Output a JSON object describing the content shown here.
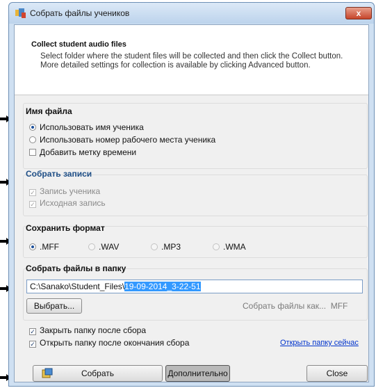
{
  "window": {
    "title": "Собрать файлы учеников",
    "close_label": "x"
  },
  "header": {
    "title": "Collect student audio files",
    "description": "Select folder where the student files will be collected and then click the Collect button. More detailed settings for collection is available by clicking Advanced button."
  },
  "filename_group": {
    "title": "Имя файла",
    "options": [
      {
        "label": "Использовать имя ученика",
        "selected": true
      },
      {
        "label": "Использовать номер рабочего места ученика",
        "selected": false
      }
    ],
    "timestamp_label": "Добавить метку времени",
    "timestamp_checked": false
  },
  "records_group": {
    "title": "Собрать записи",
    "items": [
      {
        "label": "Запись ученика",
        "checked": true,
        "enabled": false
      },
      {
        "label": "Исходная запись",
        "checked": true,
        "enabled": false
      }
    ]
  },
  "format_group": {
    "title": "Сохранить формат",
    "options": [
      {
        "label": ".MFF",
        "selected": true
      },
      {
        "label": ".WAV",
        "selected": false
      },
      {
        "label": ".MP3",
        "selected": false
      },
      {
        "label": ".WMA",
        "selected": false
      }
    ]
  },
  "folder_group": {
    "title": "Собрать файлы в папку",
    "path_prefix": "C:\\Sanako\\Student_Files\\",
    "path_selected": "19-09-2014_3-22-51",
    "browse_label": "Выбрать...",
    "collect_as_label": "Собрать файлы как...",
    "collect_as_value": "MFF"
  },
  "options": {
    "close_folder_label": "Закрыть папку после сбора",
    "close_folder_checked": true,
    "open_folder_label": "Открыть папку после окончания сбора",
    "open_folder_checked": true,
    "open_now_link": "Открыть папку сейчас"
  },
  "footer": {
    "collect_label": "Собрать",
    "advanced_label": "Дополнительно",
    "close_label": "Close"
  }
}
